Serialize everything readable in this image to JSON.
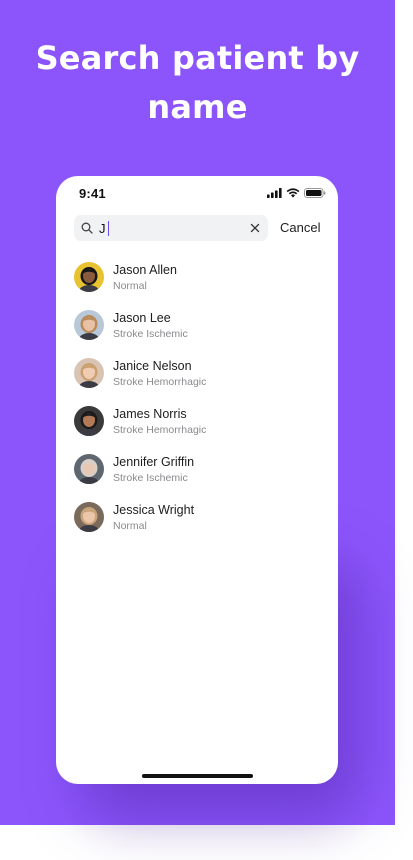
{
  "hero": {
    "title_line1": "Search patient by",
    "title_line2": "name"
  },
  "status_bar": {
    "time": "9:41"
  },
  "search": {
    "value": "J",
    "cancel_label": "Cancel"
  },
  "patients": [
    {
      "name": "Jason Allen",
      "status": "Normal",
      "avatar_bg": "#e8c230",
      "skin": "#8a5a3c",
      "hair": "#151515"
    },
    {
      "name": "Jason Lee",
      "status": "Stroke Ischemic",
      "avatar_bg": "#b9c8d8",
      "skin": "#e9c2a6",
      "hair": "#b98a5a"
    },
    {
      "name": "Janice Nelson",
      "status": "Stroke Hemorrhagic",
      "avatar_bg": "#d9c4b4",
      "skin": "#f0cdb2",
      "hair": "#caa070"
    },
    {
      "name": "James Norris",
      "status": "Stroke Hemorrhagic",
      "avatar_bg": "#3a3a3a",
      "skin": "#b47a58",
      "hair": "#1a1a1a"
    },
    {
      "name": "Jennifer Griffin",
      "status": "Stroke Ischemic",
      "avatar_bg": "#5e6670",
      "skin": "#e6c8b4",
      "hair": "#d9cfc8"
    },
    {
      "name": "Jessica Wright",
      "status": "Normal",
      "avatar_bg": "#7a6a5c",
      "skin": "#ecc6a8",
      "hair": "#c9a37a"
    }
  ],
  "colors": {
    "hero_background": "#8b55fb",
    "caret": "#6c4cf0"
  },
  "icons": {
    "search": "search-icon",
    "clear": "close-icon",
    "signal": "cellular-signal-icon",
    "wifi": "wifi-icon",
    "battery": "battery-icon"
  }
}
